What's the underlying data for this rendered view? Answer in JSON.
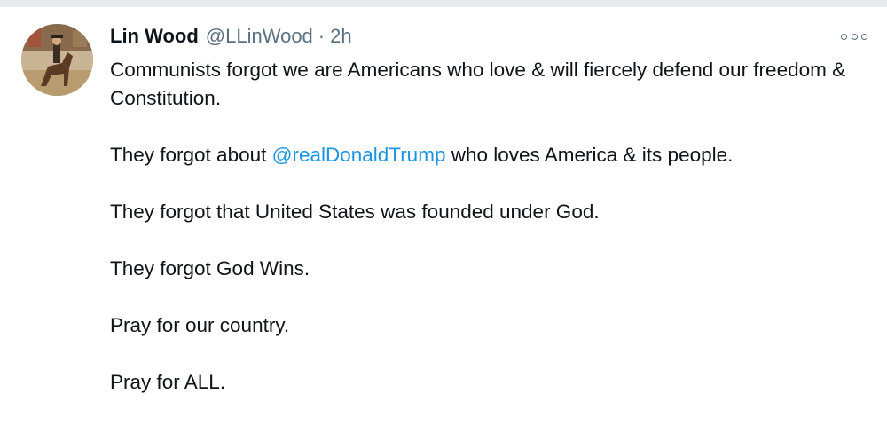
{
  "tweet": {
    "display_name": "Lin Wood",
    "handle": "@LLinWood",
    "separator": "·",
    "time": "2h",
    "more_icon": "more-horizontal-icon",
    "avatar": "avatar-horseback-rider",
    "paragraphs": {
      "p1": "Communists forgot we are Americans who love & will fiercely defend our freedom &  Constitution.",
      "p2_before": "They forgot about ",
      "p2_mention": "@realDonaldTrump",
      "p2_after": " who loves America & its people.",
      "p3": "They forgot that United States was founded under God.",
      "p4": "They forgot God Wins.",
      "p5": "Pray for our country.",
      "p6": "Pray for ALL."
    }
  },
  "colors": {
    "text": "#0f1419",
    "secondary": "#5b7083",
    "link": "#1b95e0",
    "background": "#ffffff",
    "strip": "#e6ecf0"
  }
}
